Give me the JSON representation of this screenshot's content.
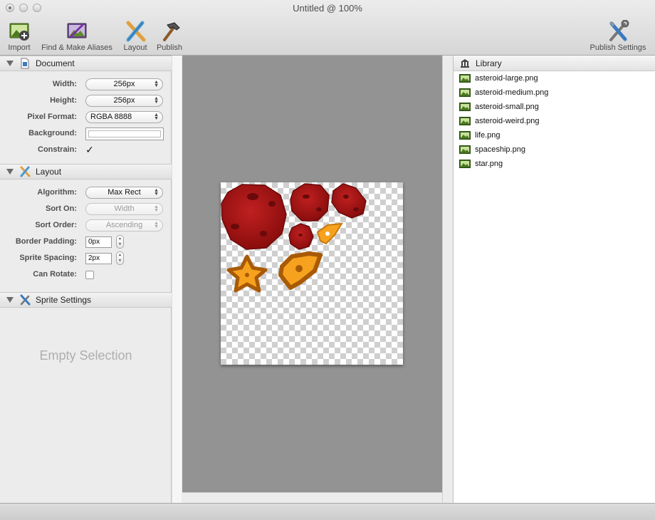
{
  "window": {
    "title": "Untitled @ 100%"
  },
  "toolbar": {
    "import": "Import",
    "find_aliases": "Find & Make Aliases",
    "layout": "Layout",
    "publish": "Publish",
    "publish_settings": "Publish Settings"
  },
  "document": {
    "title": "Document",
    "width_label": "Width:",
    "width_value": "256px",
    "height_label": "Height:",
    "height_value": "256px",
    "pixel_format_label": "Pixel Format:",
    "pixel_format_value": "RGBA 8888",
    "background_label": "Background:",
    "background_color": "#ffffff",
    "constrain_label": "Constrain:",
    "constrain_checked": true
  },
  "layout": {
    "title": "Layout",
    "algorithm_label": "Algorithm:",
    "algorithm_value": "Max Rect",
    "sort_on_label": "Sort On:",
    "sort_on_value": "Width",
    "sort_order_label": "Sort Order:",
    "sort_order_value": "Ascending",
    "border_padding_label": "Border Padding:",
    "border_padding_value": "0px",
    "sprite_spacing_label": "Sprite Spacing:",
    "sprite_spacing_value": "2px",
    "can_rotate_label": "Can Rotate:",
    "can_rotate_checked": false
  },
  "sprite_settings": {
    "title": "Sprite Settings",
    "empty_text": "Empty Selection"
  },
  "library": {
    "title": "Library",
    "files": [
      "asteroid-large.png",
      "asteroid-medium.png",
      "asteroid-small.png",
      "asteroid-weird.png",
      "life.png",
      "spaceship.png",
      "star.png"
    ]
  },
  "colors": {
    "asteroid": "#a81414",
    "sprite_orange": "#f6a21f",
    "sprite_outline": "#a85a05",
    "canvas_bg": "#939393"
  }
}
